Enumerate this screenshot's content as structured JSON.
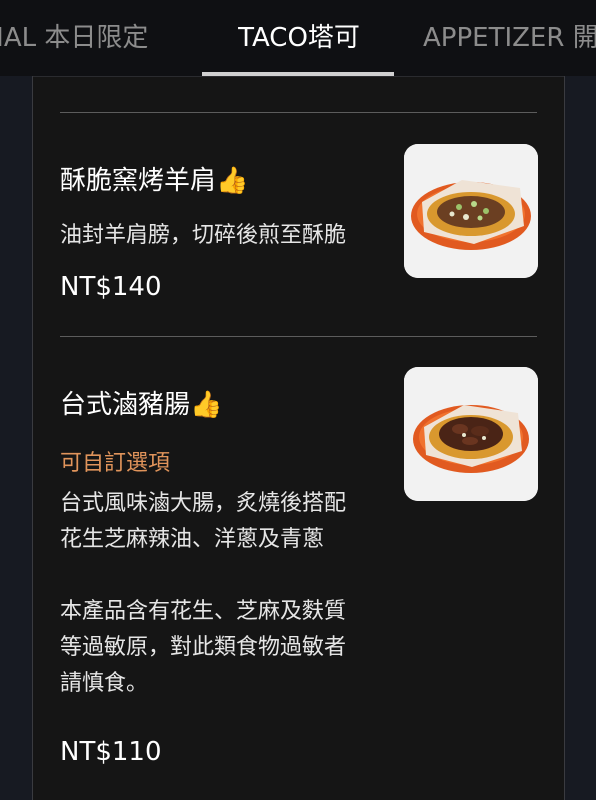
{
  "tabs": [
    {
      "label": "CIAL 本日限定"
    },
    {
      "label": "TACO塔可"
    },
    {
      "label": "APPETIZER 開"
    }
  ],
  "active_tab": 1,
  "items": [
    {
      "name": "酥脆窯烤羊肩",
      "badge_icon": "thumbs-up-emoji",
      "badge": "👍",
      "description": [
        "油封羊肩膀，切碎後煎至酥脆"
      ],
      "price": "NT$140",
      "image": "taco-lamb-photo"
    },
    {
      "name": "台式滷豬腸",
      "badge_icon": "thumbs-up-emoji",
      "badge": "👍",
      "option_label": "可自訂選項",
      "description": [
        "台式風味滷大腸，炙燒後搭配",
        "花生芝麻辣油、洋蔥及青蔥",
        "",
        "本產品含有花生、芝麻及麩質",
        "等過敏原，對此類食物過敏者",
        "請慎食。"
      ],
      "price": "NT$110",
      "image": "taco-pork-intestine-photo"
    }
  ],
  "colors": {
    "background": "#0f1013",
    "panel": "#151515",
    "option_accent": "#e0945b",
    "plate_orange": "#f06a2a"
  }
}
